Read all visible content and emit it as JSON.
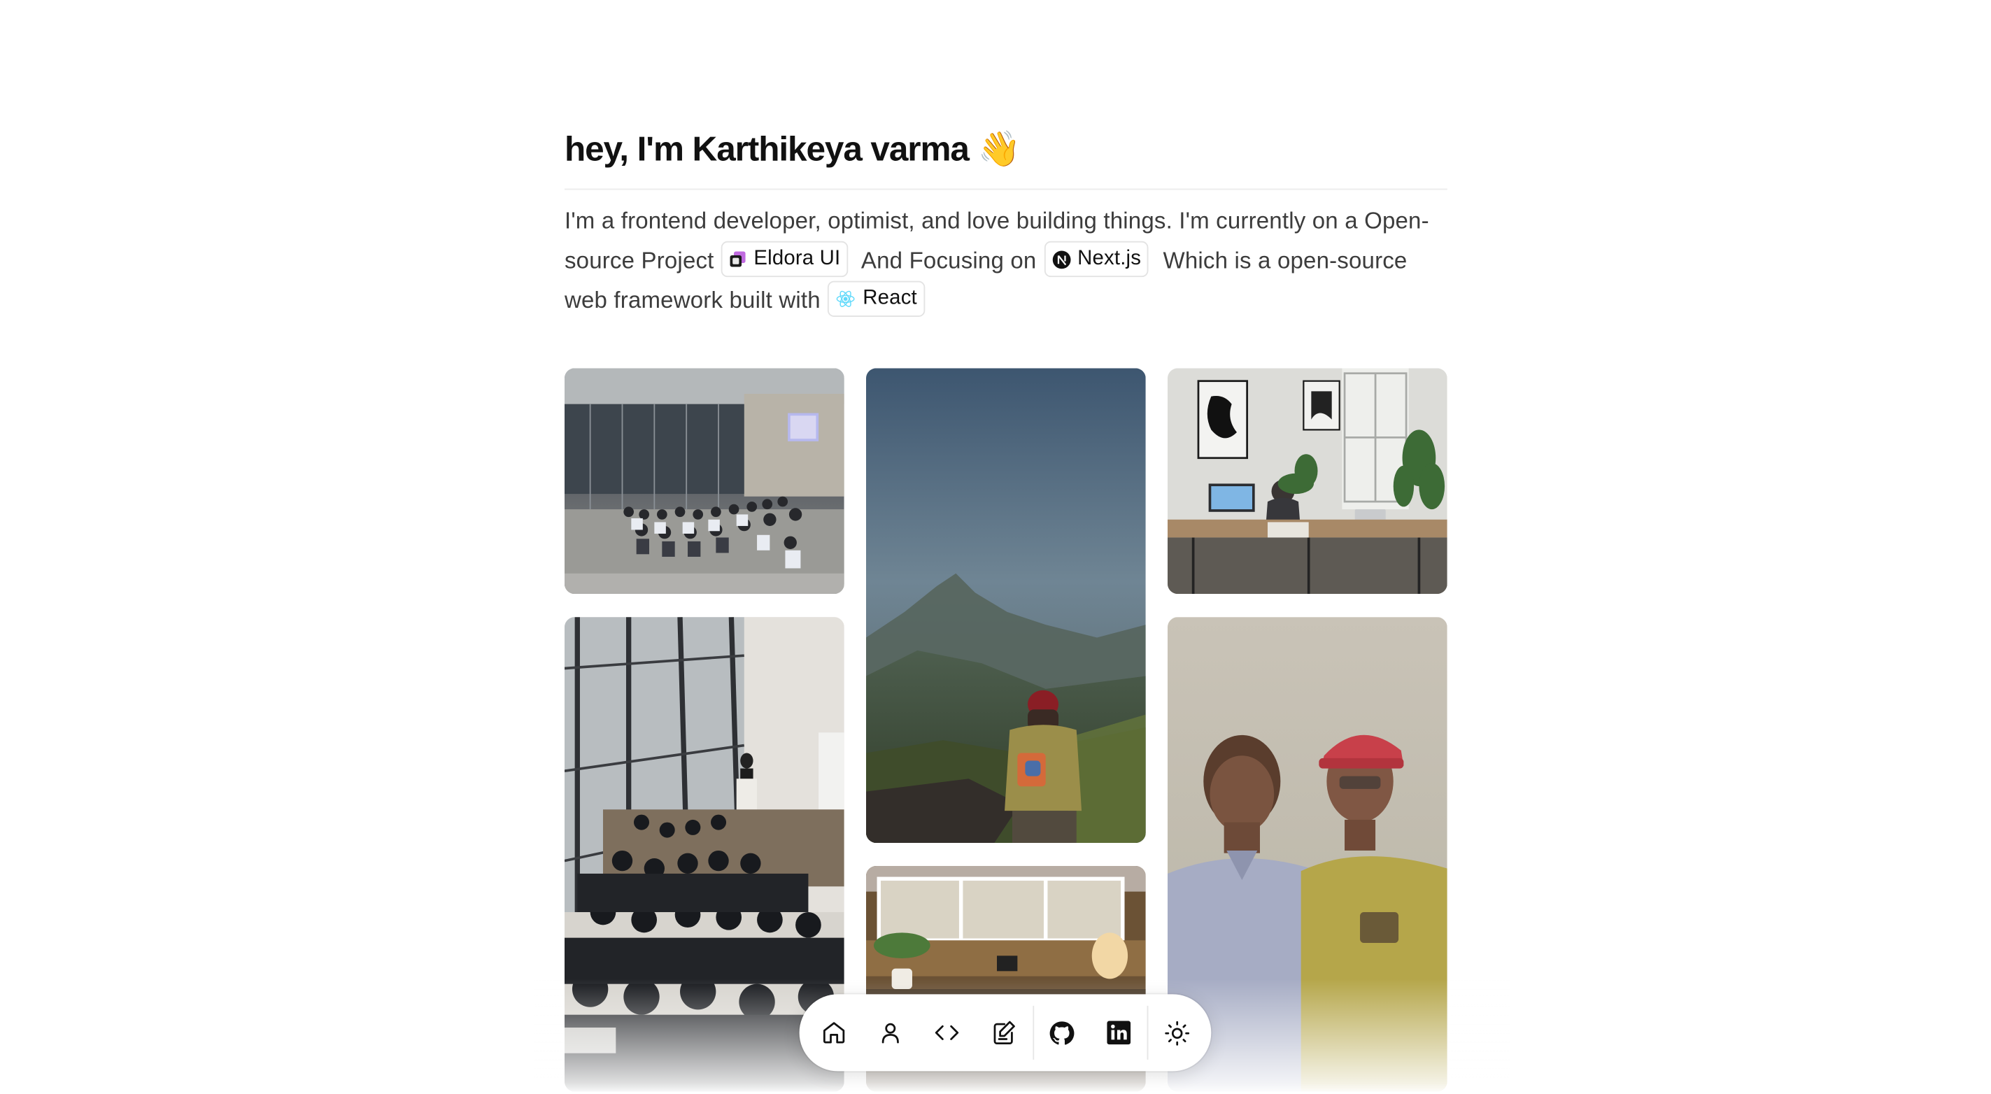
{
  "intro": {
    "title": "hey, I'm Karthikeya varma",
    "wave_emoji": "👋",
    "text_1": "I'm a frontend developer, optimist, and love building things. I'm currently on a Open-source Project",
    "chip_eldora": "Eldora UI",
    "text_2": "And Focusing on",
    "chip_next": "Next.js",
    "text_3": "Which is a open-source web framework built with",
    "chip_react": "React"
  },
  "gallery": {
    "photos": [
      {
        "name": "conference-hall-audience"
      },
      {
        "name": "misty-mountain-person"
      },
      {
        "name": "office-workspace"
      },
      {
        "name": "auditorium-speaker"
      },
      {
        "name": "two-friends-smiling"
      },
      {
        "name": "window-desk-lamp"
      }
    ]
  },
  "dock": {
    "items": [
      "home-icon",
      "user-icon",
      "code-icon",
      "pencil-notes-icon",
      "github-icon",
      "linkedin-icon",
      "sun-icon"
    ]
  },
  "colors": {
    "text": "#111111",
    "body_text": "#3c3c3c",
    "chip_border": "#e3e3e3"
  }
}
